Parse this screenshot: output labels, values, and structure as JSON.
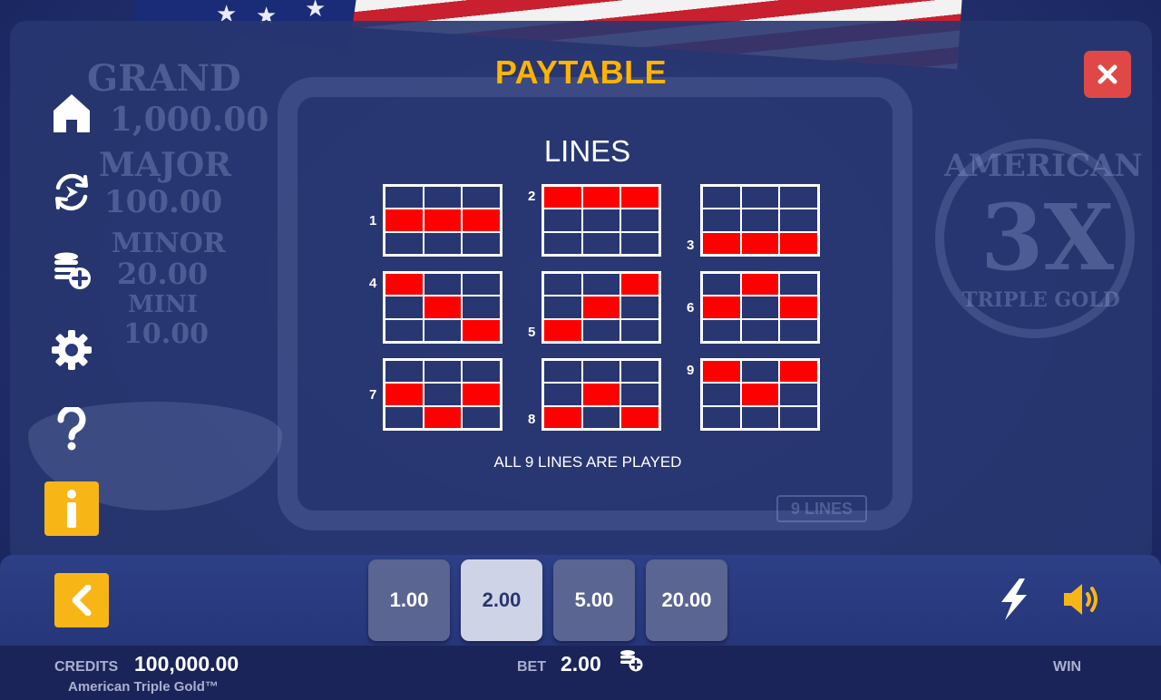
{
  "paytable": {
    "title": "PAYTABLE",
    "close_icon": "close-icon"
  },
  "background": {
    "jackpot_labels": [
      "GRAND",
      "MAJOR",
      "MINOR",
      "MINI"
    ],
    "jackpot_values": [
      "1,000.00",
      "100.00",
      "20.00",
      "10.00"
    ],
    "logo_lines": [
      "AMERICAN",
      "3X",
      "TRIPLE GOLD"
    ],
    "lines_badge": "9 LINES"
  },
  "sidebar": {
    "items": [
      {
        "icon": "home-icon",
        "active": false
      },
      {
        "icon": "autoplay-icon",
        "active": false
      },
      {
        "icon": "bet-coins-icon",
        "active": false
      },
      {
        "icon": "gear-icon",
        "active": false
      },
      {
        "icon": "help-icon",
        "active": false
      },
      {
        "icon": "info-icon",
        "active": true
      }
    ]
  },
  "lines": {
    "heading": "LINES",
    "note": "ALL 9 LINES ARE PLAYED",
    "items": [
      {
        "num": "1",
        "rows": [
          1,
          1,
          1
        ]
      },
      {
        "num": "2",
        "rows": [
          0,
          0,
          0
        ]
      },
      {
        "num": "3",
        "rows": [
          2,
          2,
          2
        ]
      },
      {
        "num": "4",
        "rows": [
          0,
          1,
          2
        ]
      },
      {
        "num": "5",
        "rows": [
          2,
          1,
          0
        ]
      },
      {
        "num": "6",
        "rows": [
          1,
          0,
          1
        ]
      },
      {
        "num": "7",
        "rows": [
          1,
          2,
          1
        ]
      },
      {
        "num": "8",
        "rows": [
          2,
          1,
          2
        ]
      },
      {
        "num": "9",
        "rows": [
          0,
          1,
          0
        ]
      }
    ]
  },
  "bottom": {
    "back_icon": "chevron-left-icon",
    "chips": [
      {
        "label": "1.00",
        "selected": false
      },
      {
        "label": "2.00",
        "selected": true
      },
      {
        "label": "5.00",
        "selected": false
      },
      {
        "label": "20.00",
        "selected": false
      }
    ],
    "turbo_icon": "lightning-icon",
    "sound_icon": "speaker-icon"
  },
  "info": {
    "credits_label": "CREDITS",
    "credits_value": "100,000.00",
    "game_name": "American Triple Gold™",
    "bet_label": "BET",
    "bet_value": "2.00",
    "win_label": "WIN"
  },
  "colors": {
    "accent": "#ffb400",
    "button_yellow": "#f8b616",
    "close_red": "#e04848",
    "line_red": "#ff0000"
  }
}
